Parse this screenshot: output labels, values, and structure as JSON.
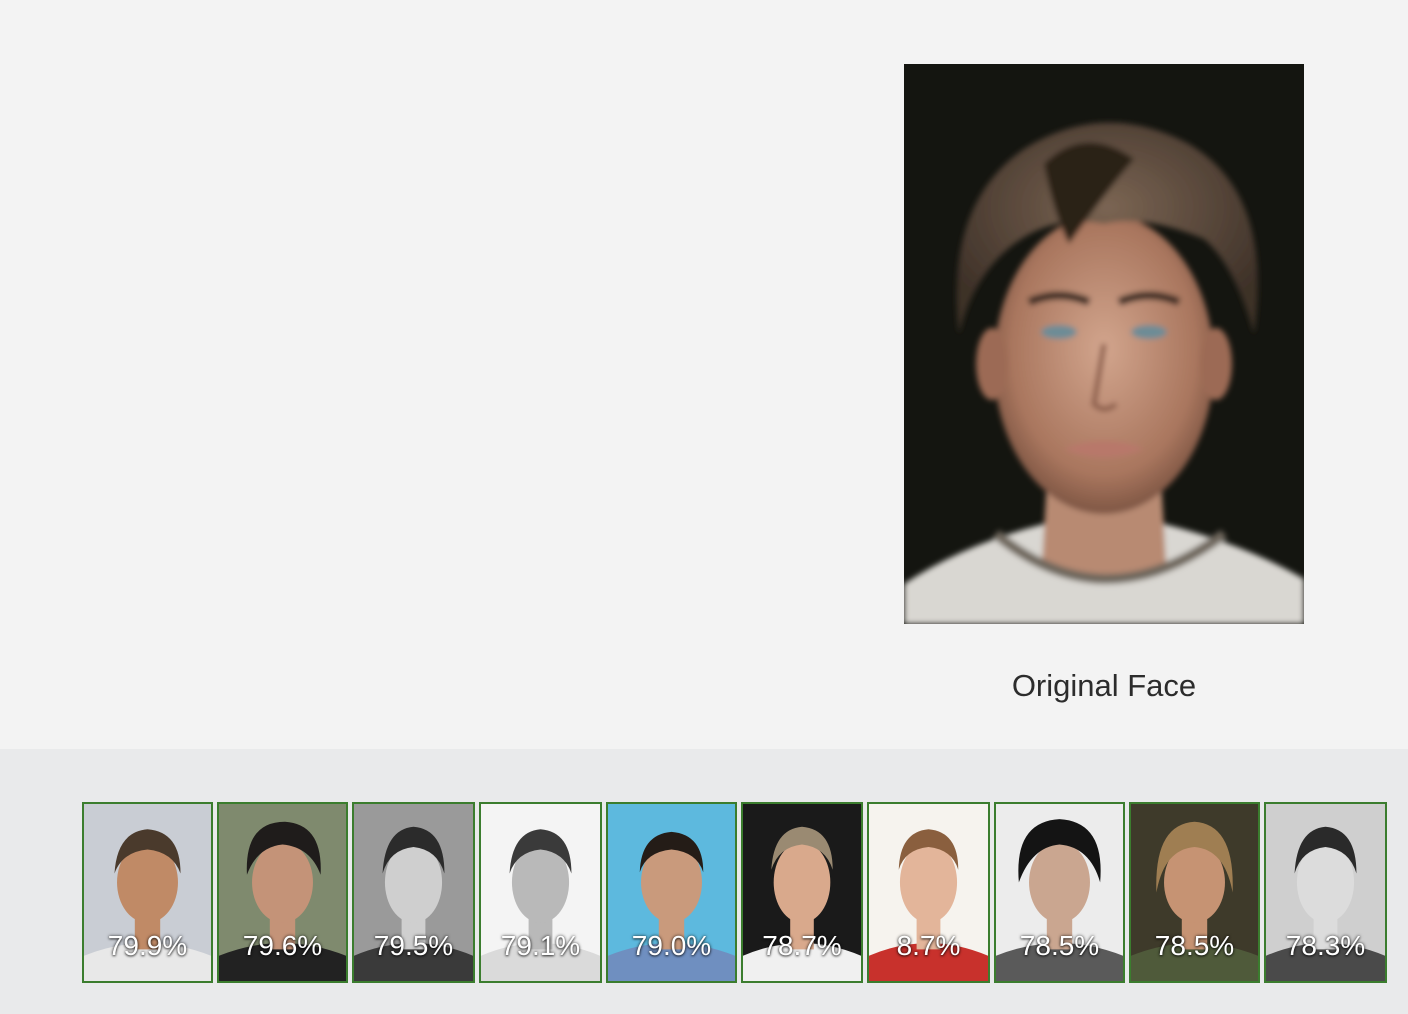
{
  "original": {
    "caption": "Original Face"
  },
  "matches": [
    {
      "score": "79.9%",
      "bg": "#c9cdd4",
      "skin": "#c08a66",
      "hair": "#4a3a2c",
      "shirt": "#e8e8e8"
    },
    {
      "score": "79.6%",
      "bg": "#7f8a6e",
      "skin": "#c49378",
      "hair": "#1f1c1b",
      "shirt": "#222222"
    },
    {
      "score": "79.5%",
      "bg": "#9a9a9a",
      "skin": "#cfcfcf",
      "hair": "#2b2b2b",
      "shirt": "#3a3a3a"
    },
    {
      "score": "79.1%",
      "bg": "#f4f4f4",
      "skin": "#b9b9b9",
      "hair": "#3a3a3a",
      "shirt": "#dadada"
    },
    {
      "score": "79.0%",
      "bg": "#5db9de",
      "skin": "#c99a7c",
      "hair": "#241c17",
      "shirt": "#6f8fc0"
    },
    {
      "score": "78.7%",
      "bg": "#1a1a1a",
      "skin": "#d9a98c",
      "hair": "#9a8a72",
      "shirt": "#f0f0f0"
    },
    {
      "score": "8.7%",
      "bg": "#f6f3ee",
      "skin": "#e3b59a",
      "hair": "#8a5f3e",
      "shirt": "#c8312c"
    },
    {
      "score": "78.5%",
      "bg": "#ececec",
      "skin": "#caa690",
      "hair": "#141414",
      "shirt": "#5a5a5a"
    },
    {
      "score": "78.5%",
      "bg": "#3e3a2a",
      "skin": "#c69373",
      "hair": "#9f7e52",
      "shirt": "#4f5a3a"
    },
    {
      "score": "78.3%",
      "bg": "#cfcfcf",
      "skin": "#dcdcdc",
      "hair": "#2a2a2a",
      "shirt": "#4a4a4a"
    }
  ]
}
